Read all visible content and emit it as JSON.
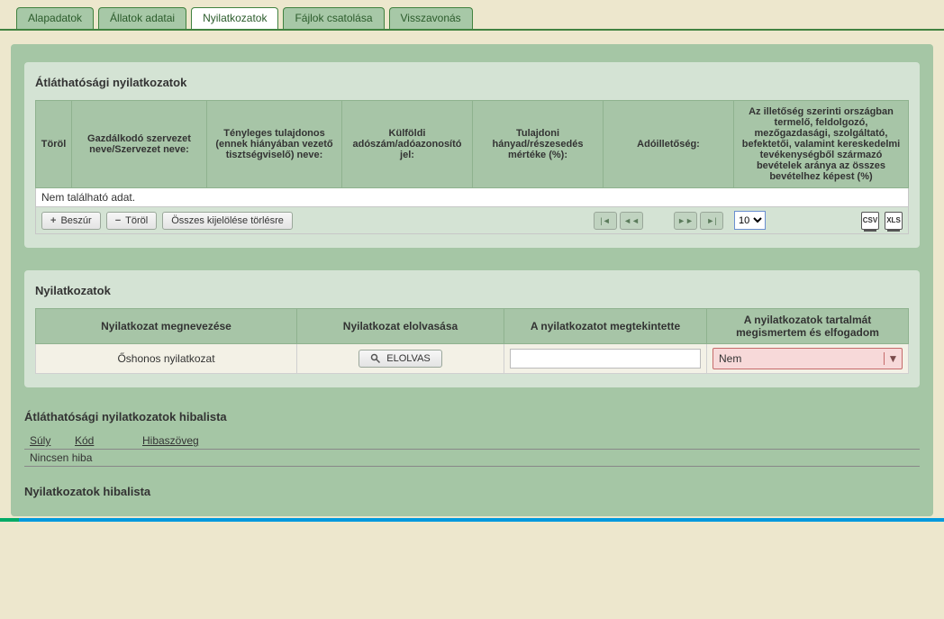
{
  "tabs": [
    {
      "label": "Alapadatok"
    },
    {
      "label": "Állatok adatai"
    },
    {
      "label": "Nyilatkozatok"
    },
    {
      "label": "Fájlok csatolása"
    },
    {
      "label": "Visszavonás"
    }
  ],
  "active_tab_index": 2,
  "panel1": {
    "title": "Átláthatósági nyilatkozatok",
    "headers": [
      "Töröl",
      "Gazdálkodó szervezet neve/Szervezet neve:",
      "Tényleges tulajdonos (ennek hiányában vezető tisztségviselő) neve:",
      "Külföldi adószám/adóazonosító jel:",
      "Tulajdoni hányad/részesedés mértéke (%):",
      "Adóilletőség:",
      "Az illetőség szerinti országban termelő, feldolgozó, mezőgazdasági, szolgáltató, befektetői, valamint kereskedelmi tevékenységből származó bevételek aránya az összes bevételhez képest (%)"
    ],
    "nodata": "Nem található adat.",
    "btn_insert": "Beszúr",
    "btn_delete": "Töröl",
    "btn_select_all": "Összes kijelölése törlésre",
    "page_size": "10",
    "export_csv": "CSV",
    "export_xls": "XLS"
  },
  "panel2": {
    "title": "Nyilatkozatok",
    "headers": [
      "Nyilatkozat megnevezése",
      "Nyilatkozat elolvasása",
      "A nyilatkozatot megtekintette",
      "A nyilatkozatok tartalmát megismertem és elfogadom"
    ],
    "row": {
      "name": "Őshonos nyilatkozat",
      "read_label": "ELOLVAS",
      "viewed": "",
      "accept_value": "Nem"
    }
  },
  "errors1": {
    "title": "Átláthatósági nyilatkozatok hibalista",
    "col_suly": "Súly",
    "col_kod": "Kód",
    "col_hiba": "Hibaszöveg",
    "row": "Nincsen hiba"
  },
  "errors2": {
    "title": "Nyilatkozatok hibalista"
  }
}
